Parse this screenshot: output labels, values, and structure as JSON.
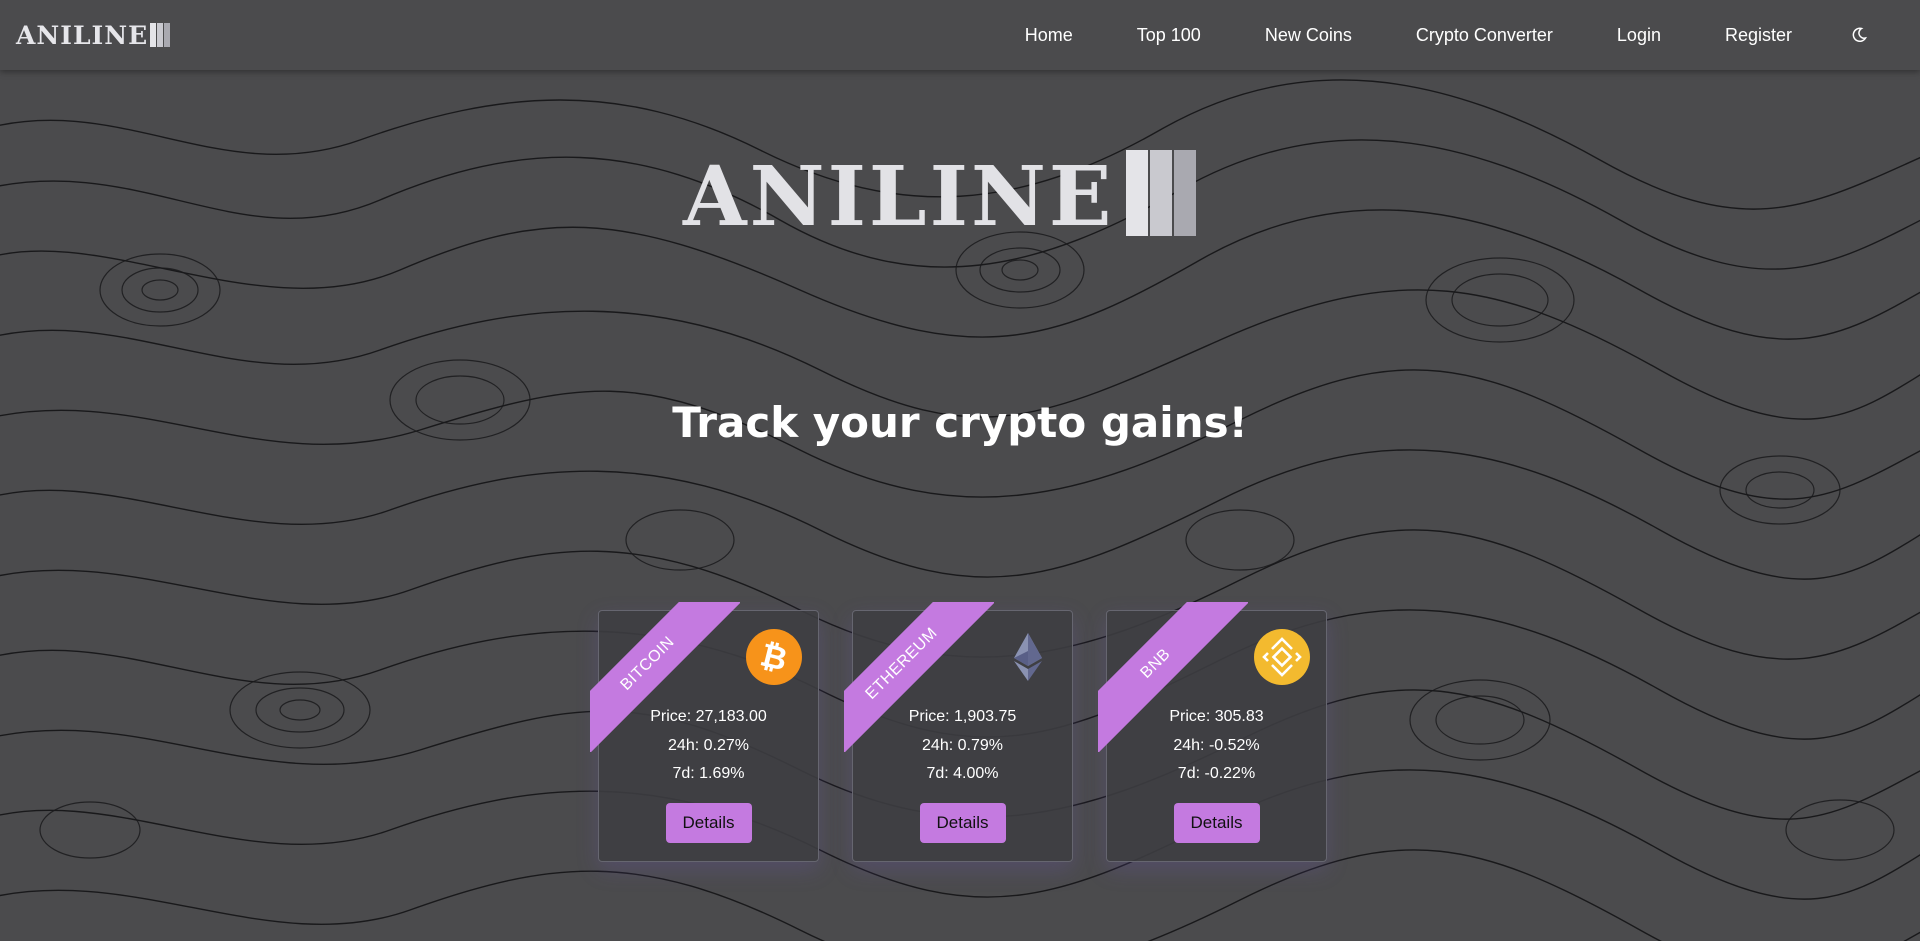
{
  "navbar": {
    "brand": "ANILINE",
    "links": [
      "Home",
      "Top 100",
      "New Coins",
      "Crypto Converter",
      "Login",
      "Register"
    ],
    "theme_toggle_icon": "moon-icon"
  },
  "hero": {
    "logo_text": "ANILINE",
    "tagline": "Track your crypto gains!"
  },
  "colors": {
    "accent": "#c47ae0",
    "background": "#4b4b4d",
    "bitcoin": "#f7931a",
    "bnb": "#f3ba2f",
    "ethereum": "#8a92b2"
  },
  "cards": [
    {
      "name": "BITCOIN",
      "icon": "bitcoin-icon",
      "price": "Price: 27,183.00",
      "change_24h": "24h: 0.27%",
      "change_7d": "7d: 1.69%",
      "button": "Details"
    },
    {
      "name": "ETHEREUM",
      "icon": "ethereum-icon",
      "price": "Price: 1,903.75",
      "change_24h": "24h: 0.79%",
      "change_7d": "7d: 4.00%",
      "button": "Details"
    },
    {
      "name": "BNB",
      "icon": "bnb-icon",
      "price": "Price: 305.83",
      "change_24h": "24h: -0.52%",
      "change_7d": "7d: -0.22%",
      "button": "Details"
    }
  ]
}
